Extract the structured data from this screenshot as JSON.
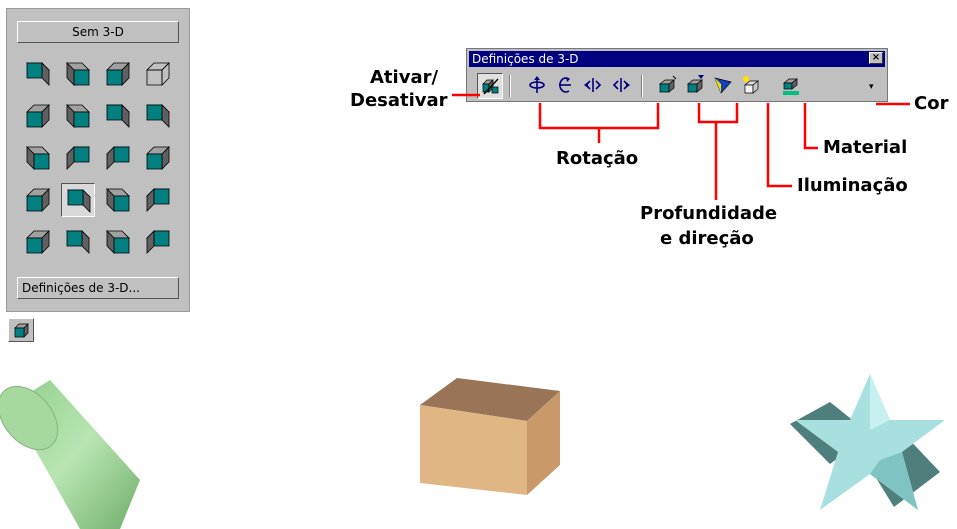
{
  "palette": {
    "no_3d_label": "Sem 3-D",
    "settings_label": "Definições de 3-D...",
    "icons": [
      "3d-style-1-icon",
      "3d-style-2-icon",
      "3d-style-3-icon",
      "3d-style-4-icon",
      "3d-style-5-icon",
      "3d-style-6-icon",
      "3d-style-7-icon",
      "3d-style-8-icon",
      "3d-style-9-icon",
      "3d-style-10-icon",
      "3d-style-11-icon",
      "3d-style-12-icon",
      "3d-style-13-icon",
      "3d-style-14-icon",
      "3d-style-15-icon",
      "3d-style-16-icon",
      "3d-style-17-icon",
      "3d-style-18-icon",
      "3d-style-19-icon",
      "3d-style-20-icon"
    ],
    "selected_index": 13,
    "colors": {
      "face": "#008080",
      "side": "#606060",
      "top": "#a0a0a0"
    }
  },
  "toolbar": {
    "title": "Definições de 3-D",
    "close_glyph": "×",
    "buttons": [
      "toggle-3d-icon",
      "tilt-down-icon",
      "tilt-up-icon",
      "tilt-left-icon",
      "tilt-right-icon",
      "depth-icon",
      "direction-icon",
      "lighting-icon",
      "surface-icon",
      "3d-color-icon"
    ],
    "dropdown_glyph": "▾",
    "title_bar_color": "#000080"
  },
  "callouts": {
    "toggle": "Ativar/\nDesativar",
    "toggle_line1": "Ativar/",
    "toggle_line2": "Desativar",
    "rotation": "Rotação",
    "depth_line1": "Profundidade",
    "depth_line2": "e direção",
    "lighting": "Iluminação",
    "material": "Material",
    "color": "Cor",
    "line_color": "#ff0000"
  },
  "shapes": {
    "cylinder_color": "#a6d8a0",
    "box_color": "#e0b684",
    "star_color": "#a8e0e0",
    "star_shadow_color": "#4f7f7c"
  }
}
